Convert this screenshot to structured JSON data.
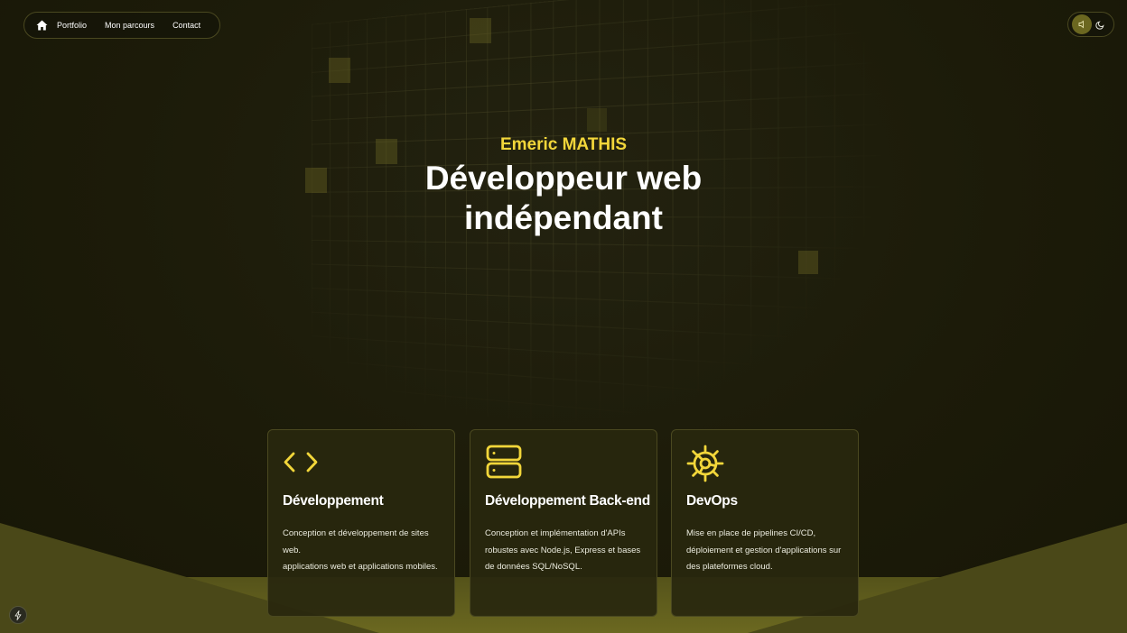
{
  "nav": {
    "items": [
      {
        "label": "Portfolio"
      },
      {
        "label": "Mon parcours"
      },
      {
        "label": "Contact"
      }
    ]
  },
  "hero": {
    "name": "Emeric MATHIS",
    "title": "Développeur web indépendant"
  },
  "cards": [
    {
      "icon": "code-icon",
      "title": "Développement",
      "description_lines": [
        "Conception et développement de sites web.",
        "applications web et applications mobiles."
      ]
    },
    {
      "icon": "server-icon",
      "title": "Développement Back-end",
      "description_lines": [
        "Conception et implémentation d'APIs robustes avec Node.js, Express et bases de données SQL/NoSQL."
      ]
    },
    {
      "icon": "gear-icon",
      "title": "DevOps",
      "description_lines": [
        "Mise en place de pipelines CI/CD, déploiement et gestion d'applications sur des plateformes cloud."
      ]
    }
  ],
  "colors": {
    "accent": "#f2d63a",
    "background": "#1b1a08",
    "card_border": "#4a4820"
  }
}
